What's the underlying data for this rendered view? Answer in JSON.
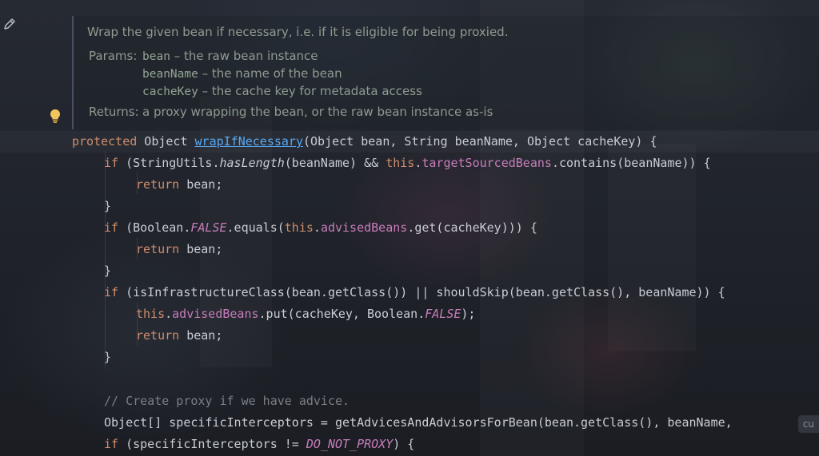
{
  "doc": {
    "description": "Wrap the given bean if necessary, i.e. if it is eligible for being proxied.",
    "params_label": "Params:",
    "params": [
      {
        "name": "bean",
        "text": " – the raw bean instance"
      },
      {
        "name": "beanName",
        "text": " – the name of the bean"
      },
      {
        "name": "cacheKey",
        "text": " – the cache key for metadata access"
      }
    ],
    "returns_label": "Returns:",
    "returns_text": "a proxy wrapping the bean, or the raw bean instance as-is"
  },
  "code": {
    "l1": {
      "a": "protected",
      "b": " Object ",
      "c": "wrapIfNecessary",
      "d": "(Object bean, String beanName, Object cacheKey) {"
    },
    "l2": {
      "a": "if",
      "b": " (StringUtils.",
      "c": "hasLength",
      "d": "(beanName) && ",
      "e": "this",
      "f": ".",
      "g": "targetSourcedBeans",
      "h": ".contains(beanName)) {"
    },
    "l3": {
      "a": "return",
      "b": " bean;"
    },
    "l4": "}",
    "l5": {
      "a": "if",
      "b": " (Boolean.",
      "c": "FALSE",
      "d": ".equals(",
      "e": "this",
      "f": ".",
      "g": "advisedBeans",
      "h": ".get(cacheKey))) {"
    },
    "l6": {
      "a": "return",
      "b": " bean;"
    },
    "l7": "}",
    "l8": {
      "a": "if",
      "b": " (isInfrastructureClass(bean.getClass()) || shouldSkip(bean.getClass(), beanName)) {"
    },
    "l9": {
      "a": "this",
      "b": ".",
      "c": "advisedBeans",
      "d": ".put(cacheKey, Boolean.",
      "e": "FALSE",
      "f": ");"
    },
    "l10": {
      "a": "return",
      "b": " bean;"
    },
    "l11": "}",
    "l12": "// Create proxy if we have advice.",
    "l13": "Object[] specificInterceptors = getAdvicesAndAdvisorsForBean(bean.getClass(), beanName,",
    "l14": {
      "a": "if",
      "b": " (specificInterceptors != ",
      "c": "DO_NOT_PROXY",
      "d": ") {"
    }
  },
  "hint": "cu",
  "icons": {
    "edit": "pencil-icon",
    "intention": "lightbulb-icon"
  },
  "colors": {
    "keyword": "#ce8d6d",
    "method": "#57a8f5",
    "field": "#c77dbb",
    "comment": "#7a7e85",
    "text": "#c9ccd4"
  }
}
